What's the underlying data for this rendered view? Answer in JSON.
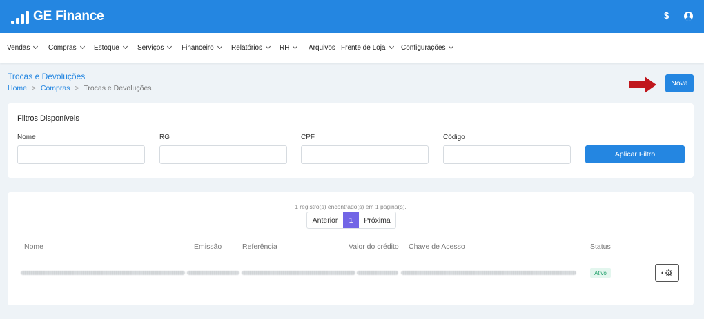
{
  "header": {
    "app_name": "GE Finance",
    "currency_icon_glyph": "$",
    "icons": [
      "logo-bars-icon",
      "dollar-icon",
      "user-circle-icon"
    ],
    "brand_color": "#2486e1"
  },
  "nav": {
    "items": [
      {
        "label": "Vendas",
        "has_dropdown": true
      },
      {
        "label": "Compras",
        "has_dropdown": true
      },
      {
        "label": "Estoque",
        "has_dropdown": true
      },
      {
        "label": "Serviços",
        "has_dropdown": true
      },
      {
        "label": "Financeiro",
        "has_dropdown": true
      },
      {
        "label": "Relatórios",
        "has_dropdown": true
      },
      {
        "label": "RH",
        "has_dropdown": true
      },
      {
        "label": "Arquivos",
        "has_dropdown": false
      },
      {
        "label": "Frente de Loja",
        "has_dropdown": true
      },
      {
        "label": "Configurações",
        "has_dropdown": true
      }
    ]
  },
  "page": {
    "title": "Trocas e Devoluções",
    "breadcrumb": [
      "Home",
      "Compras",
      "Trocas e Devoluções"
    ],
    "new_button": "Nova"
  },
  "filters": {
    "title": "Filtros Disponíveis",
    "fields": [
      {
        "label": "Nome",
        "value": "",
        "placeholder": ""
      },
      {
        "label": "RG",
        "value": "",
        "placeholder": ""
      },
      {
        "label": "CPF",
        "value": "",
        "placeholder": ""
      },
      {
        "label": "Código",
        "value": "",
        "placeholder": ""
      }
    ],
    "apply_button": "Aplicar Filtro"
  },
  "list": {
    "records_info": "1 registro(s) encontrado(s) em 1 página(s).",
    "pagination": {
      "prev": "Anterior",
      "current": "1",
      "next": "Próxima",
      "active_color": "#7265e6"
    },
    "columns": [
      "Nome",
      "Emissão",
      "Referência",
      "Valor do crédito",
      "Chave de Acesso",
      "Status"
    ],
    "rows": [
      {
        "status": "Ativo",
        "status_color": "#22a06b",
        "action_icon": "gear-icon",
        "other_cells": "redacted"
      }
    ]
  },
  "annotation": {
    "arrow_color": "#c0171d",
    "arrow_icon": "arrow-right-icon"
  }
}
